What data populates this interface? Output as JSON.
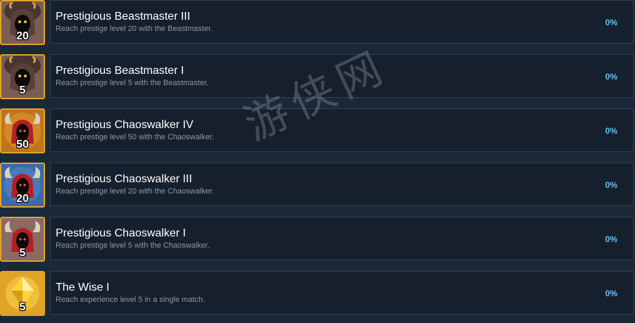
{
  "achievements": [
    {
      "title": "Prestigious Beastmaster III",
      "description": "Reach prestige level 20 with the Beastmaster.",
      "percent": "0%",
      "badge_level": "20",
      "icon": "beastmaster-icon",
      "icon_bg": "#7a5e55"
    },
    {
      "title": "Prestigious Beastmaster I",
      "description": "Reach prestige level 5 with the Beastmaster.",
      "percent": "0%",
      "badge_level": "5",
      "icon": "beastmaster-icon",
      "icon_bg": "#7a5e55"
    },
    {
      "title": "Prestigious Chaoswalker IV",
      "description": "Reach prestige level 50 with the Chaoswalker.",
      "percent": "0%",
      "badge_level": "50",
      "icon": "chaoswalker-icon",
      "icon_bg": "#c0741e"
    },
    {
      "title": "Prestigious Chaoswalker III",
      "description": "Reach prestige level 20 with the Chaoswalker.",
      "percent": "0%",
      "badge_level": "20",
      "icon": "chaoswalker-icon",
      "icon_bg": "#3a6aa8"
    },
    {
      "title": "Prestigious Chaoswalker I",
      "description": "Reach prestige level 5 with the Chaoswalker.",
      "percent": "0%",
      "badge_level": "5",
      "icon": "chaoswalker-icon",
      "icon_bg": "#8a6a64"
    },
    {
      "title": "The Wise I",
      "description": "Reach experience level 5 in a single match.",
      "percent": "0%",
      "badge_level": "5",
      "icon": "gem-icon",
      "icon_bg": "#e0a526"
    }
  ],
  "watermark_text": "游侠网",
  "colors": {
    "background": "#1b2838",
    "panel": "#16202d",
    "panel_border": "#2f4152",
    "percent": "#66c0f4",
    "description": "#8f98a0",
    "icon_border": "#e0a526"
  }
}
